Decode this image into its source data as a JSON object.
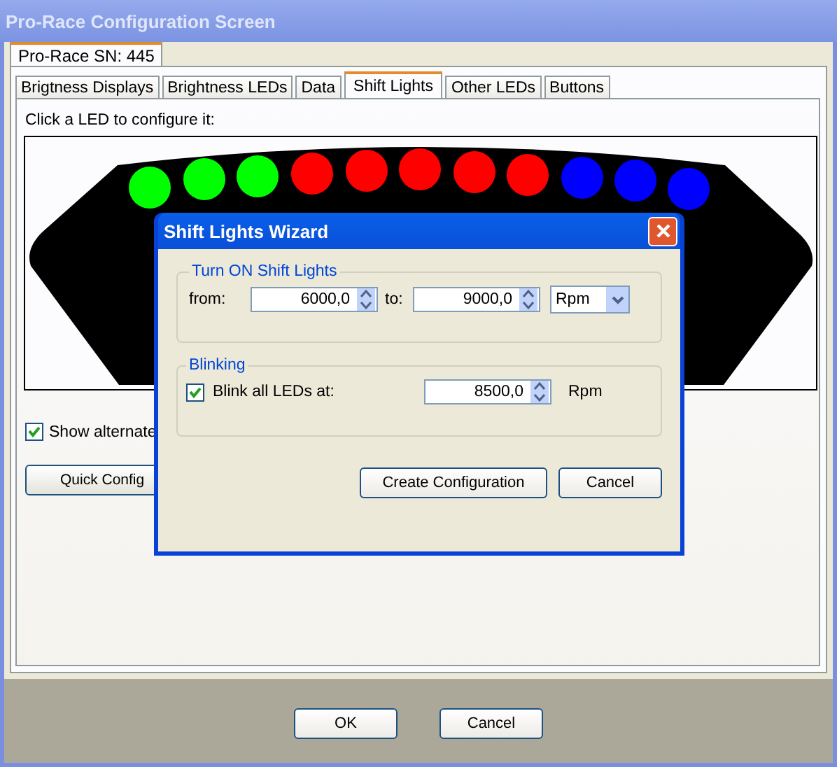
{
  "window": {
    "title": "Pro-Race Configuration Screen"
  },
  "device_tabs": [
    {
      "label": "Pro-Race SN: 445",
      "selected": true
    }
  ],
  "tabs": [
    {
      "label": "Brigtness Displays",
      "selected": false
    },
    {
      "label": "Brightness LEDs",
      "selected": false
    },
    {
      "label": "Data",
      "selected": false
    },
    {
      "label": "Shift Lights",
      "selected": true
    },
    {
      "label": "Other LEDs",
      "selected": false
    },
    {
      "label": "Buttons",
      "selected": false
    }
  ],
  "instruction": "Click a LED to configure it:",
  "leds": [
    {
      "color": "#00ff00"
    },
    {
      "color": "#00ff00"
    },
    {
      "color": "#00ff00"
    },
    {
      "color": "#ff0000"
    },
    {
      "color": "#ff0000"
    },
    {
      "color": "#ff0000"
    },
    {
      "color": "#ff0000"
    },
    {
      "color": "#ff0000"
    },
    {
      "color": "#0000ff"
    },
    {
      "color": "#0000ff"
    },
    {
      "color": "#0000ff"
    }
  ],
  "show_alternate": {
    "label": "Show alternate",
    "checked": true
  },
  "quick_config_button": "Quick Config",
  "buttons": [
    "OK",
    "Cancel"
  ],
  "dialog": {
    "title": "Shift Lights Wizard",
    "turn_on": {
      "title": "Turn ON Shift Lights",
      "from_label": "from:",
      "from_value": "6000,0",
      "to_label": "to:",
      "to_value": "9000,0",
      "unit": "Rpm"
    },
    "blinking": {
      "title": "Blinking",
      "label": "Blink all LEDs at:",
      "checked": true,
      "value": "8500,0",
      "unit": "Rpm"
    },
    "buttons": [
      "Create Configuration",
      "Cancel"
    ]
  }
}
